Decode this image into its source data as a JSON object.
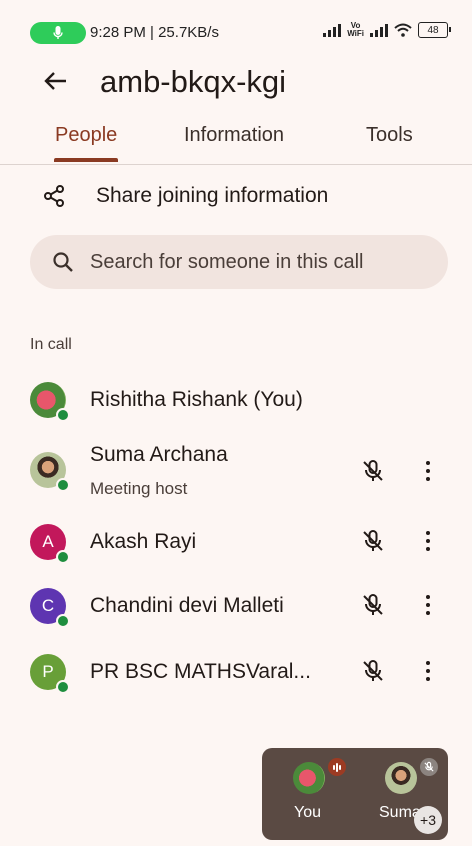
{
  "status_bar": {
    "time_speed": "9:28 PM | 25.7KB/s",
    "network_label_top": "Vo",
    "network_label_bottom": "WiFi",
    "battery": "48"
  },
  "header": {
    "title": "amb-bkqx-kgi"
  },
  "tabs": [
    {
      "label": "People",
      "active": true
    },
    {
      "label": "Information",
      "active": false
    },
    {
      "label": "Tools",
      "active": false
    }
  ],
  "share": {
    "label": "Share joining information"
  },
  "search": {
    "placeholder": "Search for someone in this call"
  },
  "section": {
    "in_call": "In call"
  },
  "participants": [
    {
      "name": "Rishitha Rishank (You)",
      "role": "",
      "avatar": "photo-flower",
      "muted": false
    },
    {
      "name": "Suma Archana",
      "role": "Meeting host",
      "avatar": "photo-person",
      "muted": true
    },
    {
      "name": "Akash Rayi",
      "initial": "A",
      "color": "#c2185b",
      "muted": true
    },
    {
      "name": "Chandini devi Malleti",
      "initial": "C",
      "color": "#5e35b1",
      "muted": true
    },
    {
      "name": "PR BSC MATHSVaral...",
      "initial": "P",
      "color": "#689f38",
      "muted": true
    }
  ],
  "mini_tile": {
    "you_label": "You",
    "other_label": "Suma",
    "extra_count": "+3"
  },
  "colors": {
    "accent": "#8a3a22",
    "background": "#fdf6f3",
    "online": "#1e8e3e",
    "mic_active": "#2ecc5a"
  }
}
